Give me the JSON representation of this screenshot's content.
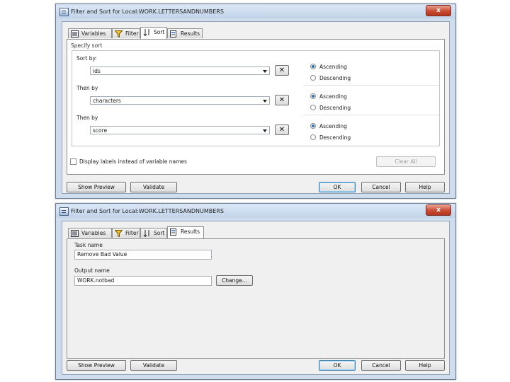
{
  "window1": {
    "title": "Filter and Sort for Local:WORK.LETTERSANDNUMBERS",
    "close": "x",
    "tabs": [
      "Variables",
      "Filter",
      "Sort",
      "Results"
    ],
    "active_tab": "Sort",
    "group_label": "Specify sort",
    "rows": [
      {
        "label": "Sort by:",
        "value": "ids",
        "asc": "Ascending",
        "desc": "Descending",
        "selected": "Ascending"
      },
      {
        "label": "Then by",
        "value": "characters",
        "asc": "Ascending",
        "desc": "Descending",
        "selected": "Ascending"
      },
      {
        "label": "Then by",
        "value": "score",
        "asc": "Ascending",
        "desc": "Descending",
        "selected": "Ascending"
      }
    ],
    "checkbox_label": "Display labels instead of variable names",
    "clear_all": "Clear All",
    "buttons": {
      "preview": "Show Preview",
      "validate": "Validate",
      "ok": "OK",
      "cancel": "Cancel",
      "help": "Help"
    }
  },
  "window2": {
    "title": "Filter and Sort for Local:WORK.LETTERSANDNUMBERS",
    "close": "x",
    "tabs": [
      "Variables",
      "Filter",
      "Sort",
      "Results"
    ],
    "active_tab": "Results",
    "task_name_label": "Task name",
    "task_name_value": "Remove Bad Value",
    "output_name_label": "Output name",
    "output_name_value": "WORK.notbad",
    "change": "Change...",
    "buttons": {
      "preview": "Show Preview",
      "validate": "Validate",
      "ok": "OK",
      "cancel": "Cancel",
      "help": "Help"
    }
  }
}
